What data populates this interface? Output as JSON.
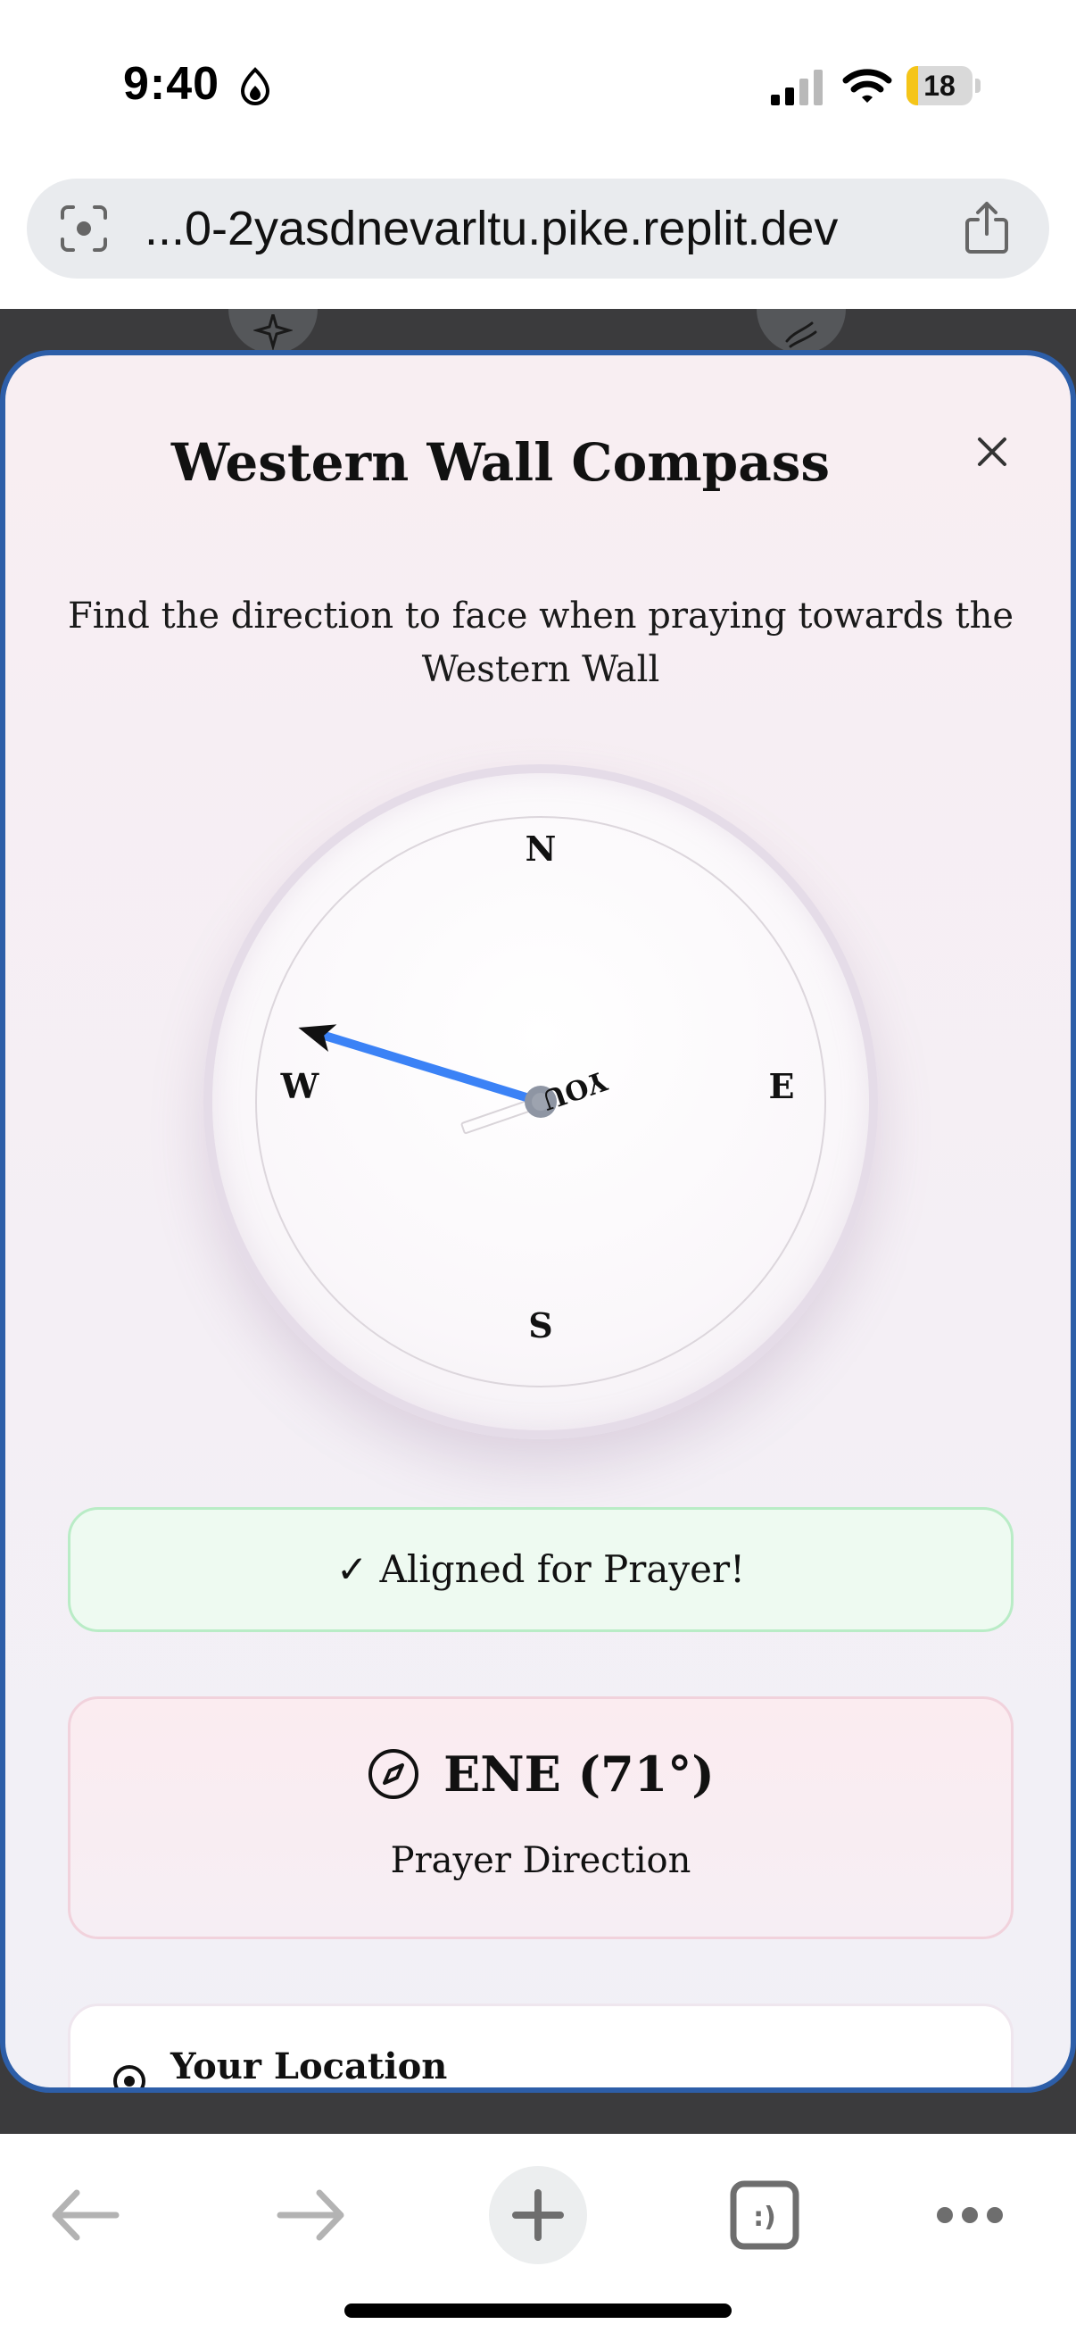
{
  "status_bar": {
    "time": "9:40",
    "battery_level": "18",
    "battery_fraction": 0.18,
    "icons": [
      "focus-icon",
      "signal-icon",
      "wifi-icon"
    ]
  },
  "browser": {
    "url": "...0-2yasdnevarltu.pike.replit.dev",
    "icons": [
      "camera-search-icon",
      "share-icon"
    ]
  },
  "modal": {
    "title": "Western Wall Compass",
    "subtitle": "Find the direction to face when praying towards the Western Wall",
    "close_icon": "close-icon"
  },
  "compass": {
    "cardinals": {
      "n": "N",
      "e": "E",
      "s": "S",
      "w": "W"
    },
    "center_label": "YOU",
    "direction_needle_bearing_deg": 71,
    "device_heading_bearing_deg": 287,
    "colors": {
      "device_needle": "#3b82f6",
      "direction_needle": "#e6c6d3",
      "hub": "#8e95a3"
    }
  },
  "status": {
    "aligned_text": "✓ Aligned for Prayer!",
    "accent": "#b9ecc6"
  },
  "direction": {
    "value": "ENE (71°)",
    "label": "Prayer Direction",
    "icon": "compass-icon"
  },
  "location": {
    "title": "Your Location",
    "icon": "location-target-icon"
  },
  "toolbar": {
    "icons": [
      "back-arrow-icon",
      "forward-arrow-icon",
      "plus-icon",
      "tabs-icon",
      "more-icon"
    ],
    "tabs_glyph": ":)"
  }
}
